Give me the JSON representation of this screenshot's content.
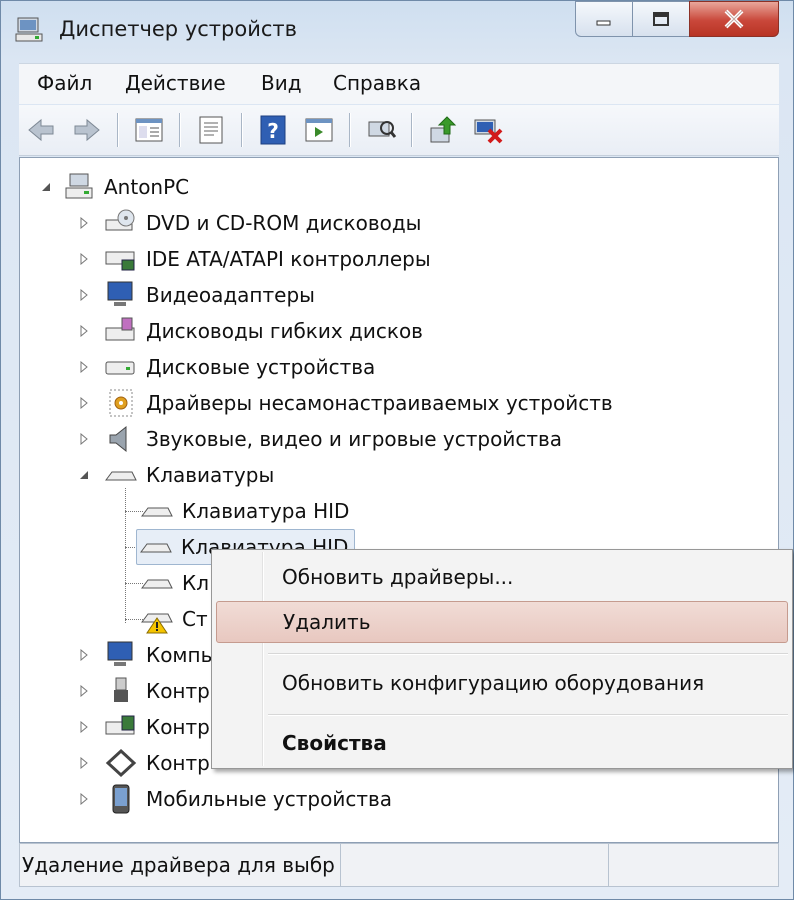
{
  "window": {
    "title": "Диспетчер устройств"
  },
  "menu": {
    "items": [
      "Файл",
      "Действие",
      "Вид",
      "Справка"
    ]
  },
  "toolbar": {
    "icons": [
      "back-icon",
      "forward-icon",
      "show-hide-tree-icon",
      "properties-icon",
      "help-icon",
      "run-action-icon",
      "scan-hardware-icon",
      "update-driver-icon",
      "uninstall-icon"
    ]
  },
  "tree": {
    "root": "AntonPC",
    "items": [
      {
        "label": "DVD и CD-ROM дисководы",
        "icon": "dvd-drive-icon"
      },
      {
        "label": "IDE ATA/ATAPI контроллеры",
        "icon": "ide-controller-icon"
      },
      {
        "label": "Видеоадаптеры",
        "icon": "display-adapter-icon"
      },
      {
        "label": "Дисководы гибких дисков",
        "icon": "floppy-drive-icon"
      },
      {
        "label": "Дисковые устройства",
        "icon": "disk-drive-icon"
      },
      {
        "label": "Драйверы несамонастраиваемых устройств",
        "icon": "non-pnp-driver-icon"
      },
      {
        "label": "Звуковые, видео и игровые устройства",
        "icon": "speaker-icon"
      },
      {
        "label": "Клавиатуры",
        "icon": "keyboard-icon",
        "expanded": true
      },
      {
        "label": "Компь",
        "icon": "computer-icon"
      },
      {
        "label": "Контр",
        "icon": "usb-controller-icon"
      },
      {
        "label": "Контр",
        "icon": "storage-controller-icon"
      },
      {
        "label": "Контр",
        "icon": "network-controller-icon"
      },
      {
        "label": "Мобильные устройства",
        "icon": "mobile-device-icon"
      }
    ],
    "keyboards": [
      {
        "label": "Клавиатура HID"
      },
      {
        "label": "Клавиатура HID",
        "selected": true
      },
      {
        "label": "Кл"
      },
      {
        "label": "Ст",
        "warning": true
      }
    ]
  },
  "context_menu": {
    "items": [
      {
        "label": "Обновить драйверы..."
      },
      {
        "label": "Удалить",
        "highlighted": true
      },
      {
        "label": "Обновить конфигурацию оборудования"
      },
      {
        "label": "Свойства",
        "bold": true
      }
    ]
  },
  "status": {
    "text": "Удаление драйвера для выбр"
  }
}
